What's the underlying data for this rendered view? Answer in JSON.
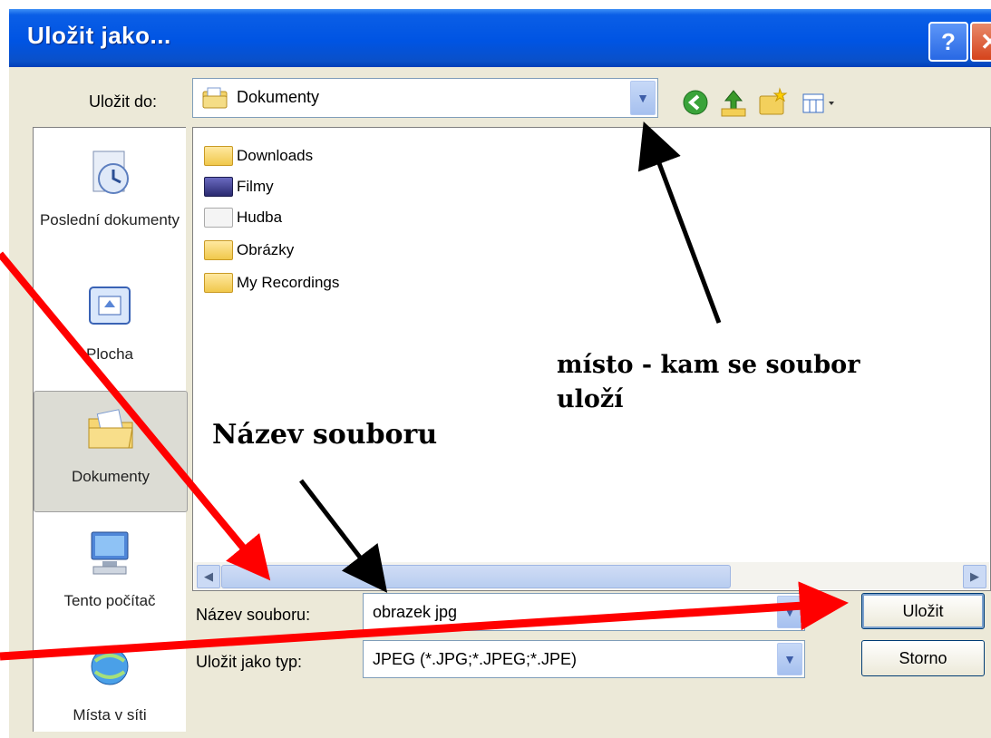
{
  "window": {
    "title": "Uložit jako...",
    "help_glyph": "?",
    "close_glyph": "✕"
  },
  "location": {
    "label": "Uložit do:",
    "value": "Dokumenty"
  },
  "places": [
    {
      "label": "Poslední dokumenty",
      "icon": "recent-documents-icon"
    },
    {
      "label": "Plocha",
      "icon": "desktop-icon"
    },
    {
      "label": "Dokumenty",
      "icon": "documents-icon",
      "selected": true
    },
    {
      "label": "Tento počítač",
      "icon": "computer-icon"
    },
    {
      "label": "Místa v síti",
      "icon": "network-icon"
    }
  ],
  "files": [
    {
      "name": "Downloads",
      "icon": "folder-icon"
    },
    {
      "name": "Filmy",
      "icon": "video-folder-icon"
    },
    {
      "name": "Hudba",
      "icon": "music-folder-icon"
    },
    {
      "name": "Obrázky",
      "icon": "pictures-folder-icon"
    },
    {
      "name": "My Recordings",
      "icon": "folder-icon"
    }
  ],
  "filename": {
    "label": "Název souboru:",
    "value": "obrazek jpg"
  },
  "filetype": {
    "label": "Uložit jako typ:",
    "value": "JPEG (*.JPG;*.JPEG;*.JPE)"
  },
  "buttons": {
    "save": "Uložit",
    "cancel": "Storno"
  },
  "annotations": {
    "location_note_line1": "místo - kam se soubor",
    "location_note_line2": "uloží",
    "filename_note": "Název souboru"
  },
  "colors": {
    "titlebar": "#0054e3",
    "dialog_bg": "#ece9d8",
    "annotation_arrow_red": "#ff0000",
    "annotation_arrow_black": "#000000"
  }
}
